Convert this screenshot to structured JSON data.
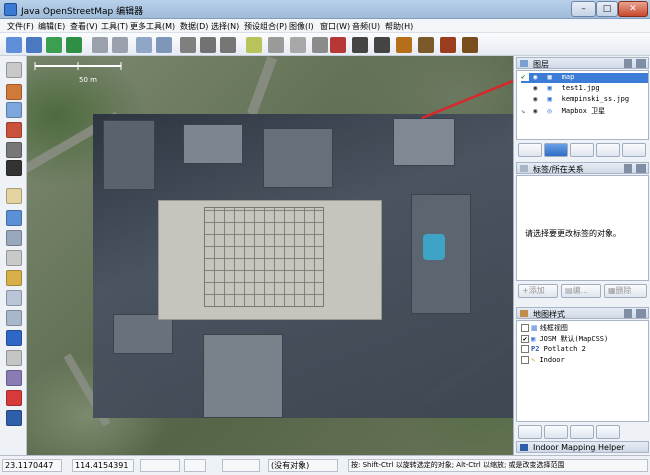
{
  "window": {
    "title": "Java OpenStreetMap 编辑器",
    "minimize_label": "–",
    "maximize_label": "□",
    "close_label": "✕"
  },
  "menu": [
    {
      "label": "文件(F)"
    },
    {
      "label": "编辑(E)"
    },
    {
      "label": "查看(V)"
    },
    {
      "label": "工具(T)"
    },
    {
      "label": "更多工具(M)"
    },
    {
      "label": "数据(D)"
    },
    {
      "label": "选择(N)"
    },
    {
      "label": "预设组合(P)"
    },
    {
      "label": "图像(I)"
    },
    {
      "label": "窗口(W)"
    },
    {
      "label": "音频(U)"
    },
    {
      "label": "帮助(H)"
    }
  ],
  "map": {
    "scale_label": "50 m"
  },
  "layers_panel": {
    "title": "图层",
    "layers": [
      {
        "name": "map",
        "selected": true,
        "visible": true,
        "active": true
      },
      {
        "name": "test1.jpg",
        "selected": false,
        "visible": true,
        "active": false
      },
      {
        "name": "kempinski_ss.jpg",
        "selected": false,
        "visible": true,
        "active": false
      },
      {
        "name": "Mapbox 卫星",
        "selected": false,
        "visible": true,
        "active": false
      }
    ]
  },
  "tags_panel": {
    "title": "标签/所在关系",
    "empty_message": "请选择要更改标签的对象。",
    "add_label": "添加",
    "edit_label": "编...",
    "delete_label": "删除"
  },
  "styles_panel": {
    "title": "地图样式",
    "styles": [
      {
        "name": "线框视图",
        "checked": false
      },
      {
        "name": "JOSM 默认(MapCSS)",
        "checked": true
      },
      {
        "name": "Potlatch 2",
        "checked": false
      },
      {
        "name": "Indoor",
        "checked": false
      }
    ]
  },
  "bottom_panel": {
    "title": "Indoor Mapping Helper"
  },
  "status": {
    "lat": "23.1170447",
    "lon": "114.4154391",
    "selection": "(没有对象)",
    "hint": "按: Shift-Ctrl 以旋转选定的对象; Alt-Ctrl 以缩放; 或是改变选择范围"
  }
}
